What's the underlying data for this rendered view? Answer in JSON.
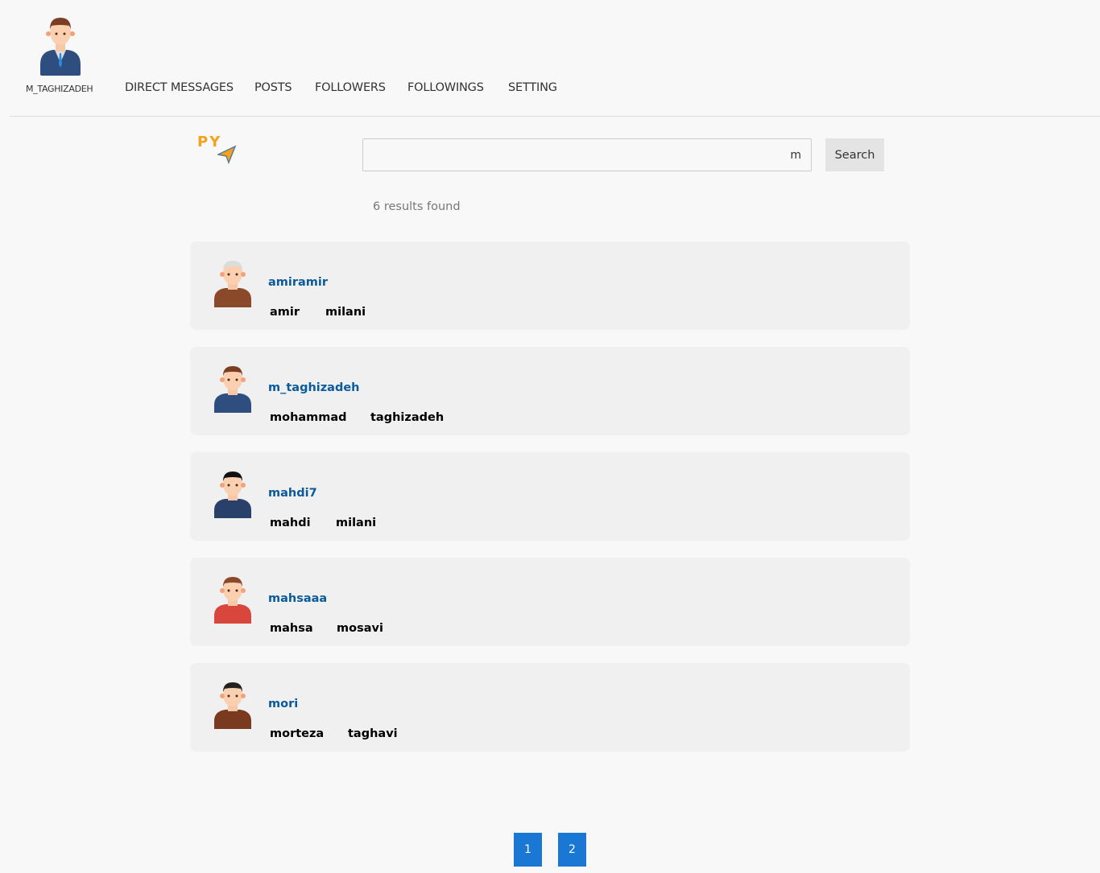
{
  "header": {
    "username": "M_TAGHIZADEH",
    "nav": [
      "DIRECT MESSAGES",
      "POSTS",
      "FOLLOWERS",
      "FOLLOWINGS",
      "SETTING"
    ]
  },
  "logo": {
    "text": "PY",
    "icon": "paper-plane-icon"
  },
  "search": {
    "value": "m",
    "button": "Search",
    "results": "6 results found"
  },
  "users": [
    {
      "username": "amiramir",
      "first": "amir",
      "last": "milani",
      "hair": "#dcdcdc",
      "body": "#8a4a2a"
    },
    {
      "username": "m_taghizadeh",
      "first": "mohammad",
      "last": "taghizadeh",
      "hair": "#7a3f22",
      "body": "#2f4e80"
    },
    {
      "username": "mahdi7",
      "first": "mahdi",
      "last": "milani",
      "hair": "#111111",
      "body": "#28406a"
    },
    {
      "username": "mahsaaa",
      "first": "mahsa",
      "last": "mosavi",
      "hair": "#8a4a2a",
      "body": "#d9463c"
    },
    {
      "username": "mori",
      "first": "morteza",
      "last": "taghavi",
      "hair": "#222222",
      "body": "#7a3a20"
    }
  ],
  "pagination": [
    "1",
    "2"
  ],
  "colors": {
    "link": "#0a5a9c",
    "page": "#1a78d4"
  }
}
